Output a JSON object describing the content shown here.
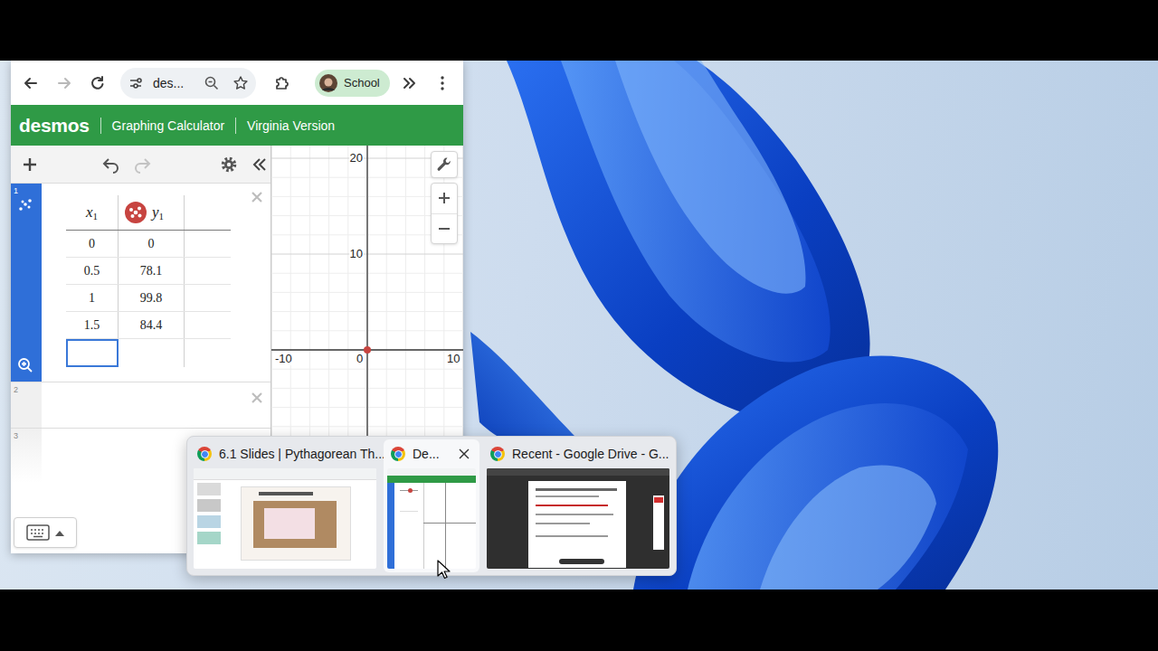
{
  "browser": {
    "address": "des...",
    "profile": "School",
    "forward_disabled": true
  },
  "app": {
    "logo": "desmos",
    "title": "Graphing Calculator",
    "version": "Virginia Version"
  },
  "calculator_toolbar": {
    "redo_disabled": true
  },
  "expressions": [
    {
      "number": "1",
      "kind": "table",
      "selected": true,
      "input_focused": true,
      "columns": [
        {
          "name": "x",
          "sub": "1"
        },
        {
          "name": "y",
          "sub": "1",
          "color": "#c74440"
        }
      ],
      "rows": [
        [
          "0",
          "0"
        ],
        [
          "0.5",
          "78.1"
        ],
        [
          "1",
          "99.8"
        ],
        [
          "1.5",
          "84.4"
        ]
      ]
    },
    {
      "number": "2",
      "kind": "empty",
      "selected": false
    },
    {
      "number": "3",
      "kind": "empty",
      "selected": false
    }
  ],
  "graph": {
    "y_ticks": [
      "20",
      "10"
    ],
    "x_ticks": [
      "-10",
      "0",
      "10"
    ],
    "series": [
      {
        "x": [
          0,
          0.5,
          1,
          1.5
        ],
        "y": [
          0,
          78.1,
          99.8,
          84.4
        ],
        "color": "#c74440"
      }
    ]
  },
  "taskbar_previews": [
    {
      "title": "6.1 Slides | Pythagorean Th...",
      "selected": false,
      "kind": "slides"
    },
    {
      "title": "De...",
      "selected": true,
      "kind": "calculator"
    },
    {
      "title": "Recent - Google Drive - G...",
      "selected": false,
      "kind": "drive"
    }
  ]
}
